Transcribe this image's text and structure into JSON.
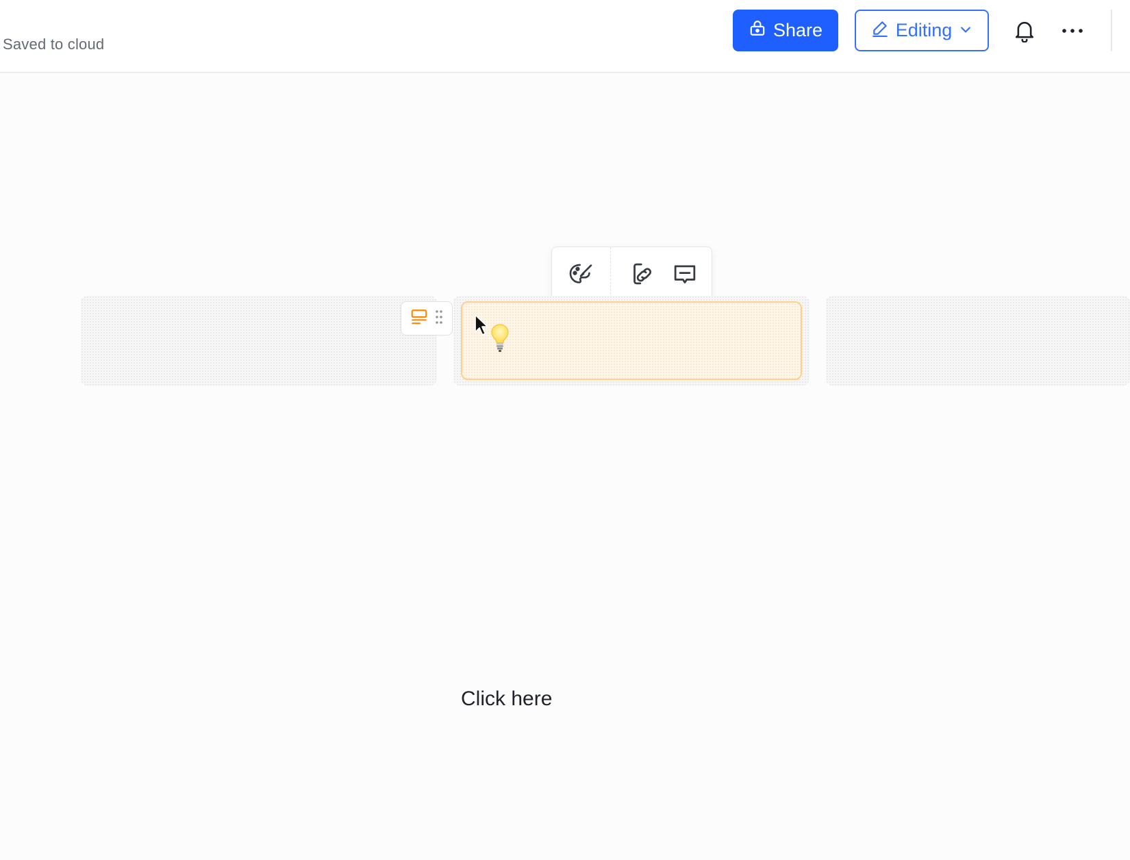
{
  "header": {
    "status": "Saved to cloud",
    "share_label": "Share",
    "edit_mode_label": "Editing"
  },
  "toolbar": {
    "buttons": [
      "palette-icon",
      "link-icon",
      "comment-icon"
    ]
  },
  "callout": {
    "emoji": "bulb-icon",
    "text": ""
  },
  "hint": "Click here",
  "colors": {
    "primary": "#1f5fff",
    "accent_border": "#3370ff",
    "callout_bg": "#fff6ea",
    "callout_border": "#ffcf8b",
    "handle_icon": "#ff8800"
  }
}
